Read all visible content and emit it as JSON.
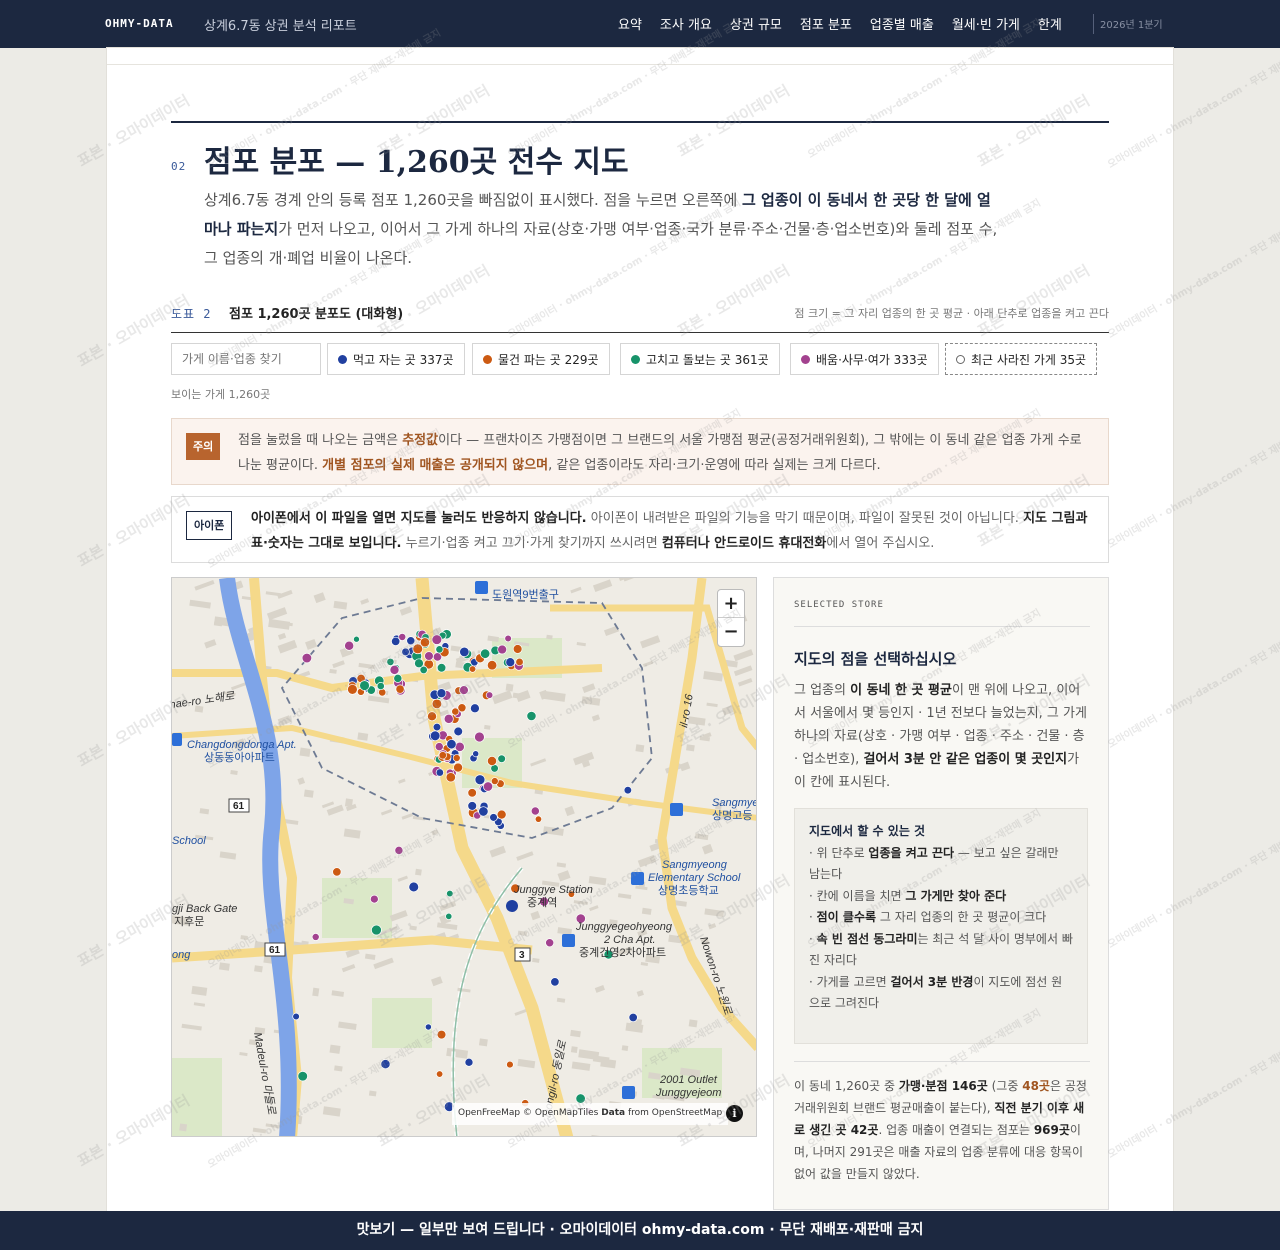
{
  "header": {
    "brand": "OHMY-DATA",
    "report_title": "상계6.7동 상권 분석 리포트",
    "nav": [
      "요약",
      "조사 개요",
      "상권 규모",
      "점포 분포",
      "업종별 매출",
      "월세·빈 가게",
      "한계"
    ],
    "period": "2026년 1분기"
  },
  "section": {
    "number": "02",
    "title": "점포 분포 — 1,260곳 전수 지도",
    "lead_1": "상계6.7동 경계 안의 등록 점포 1,260곳을 빠짐없이 표시했다. 점을 누르면 오른쪽에 ",
    "lead_bold": "그 업종이 이 동네서 한 곳당 한 달에 얼마나 파는지",
    "lead_2": "가 먼저 나오고, 이어서 그 가게 하나의 자료(상호·가맹 여부·업종·국가 분류·주소·건물·층·업소번호)와 둘레 점포 수, 그 업종의 개·폐업 비율이 나온다."
  },
  "figure": {
    "label": "도표 2",
    "title": "점포 1,260곳 분포도 (대화형)",
    "note": "점 크기 = 그 자리 업종의 한 곳 평균 · 아래 단추로 업종을 켜고 끈다"
  },
  "filters": {
    "search_placeholder": "가게 이름·업종 찾기",
    "chips": [
      {
        "label": "먹고 자는 곳 337곳",
        "color": "#2140a0"
      },
      {
        "label": "물건 파는 곳 229곳",
        "color": "#cc5a12"
      },
      {
        "label": "고치고 돌보는 곳 361곳",
        "color": "#17936a"
      },
      {
        "label": "배움·사무·여가 333곳",
        "color": "#a3428f"
      },
      {
        "label": "최근 사라진 가게 35곳",
        "color": "#888888"
      }
    ],
    "visible_count": "보이는 가게 1,260곳"
  },
  "warning": {
    "tag": "주의",
    "text_1": "점을 눌렀을 때 나오는 금액은 ",
    "bold_1": "추정값",
    "text_2": "이다 — 프랜차이즈 가맹점이면 그 브랜드의 서울 가맹점 평균(공정거래위원회), 그 밖에는 이 동네 같은 업종 가게 수로 나눈 평균이다. ",
    "bold_2": "개별 점포의 실제 매출은 공개되지 않으며",
    "text_3": ", 같은 업종이라도 자리·크기·운영에 따라 실제는 크게 다르다."
  },
  "iphone": {
    "tag": "아이폰",
    "bold_1": "아이폰에서 이 파일을 열면 지도를 눌러도 반응하지 않습니다.",
    "text_1": " 아이폰이 내려받은 파일의 기능을 막기 때문이며, 파일이 잘못된 것이 아닙니다. ",
    "bold_2": "지도 그림과 표·숫자는 그대로 보입니다.",
    "text_2": " 누르기·업종 켜고 끄기·가게 찾기까지 쓰시려면 ",
    "bold_3": "컴퓨터나 안드로이드 휴대전화",
    "text_3": "에서 열어 주십시오."
  },
  "map": {
    "zoom_in": "+",
    "zoom_out": "−",
    "attribution_1": "OpenFreeMap © OpenMapTiles ",
    "attribution_bold": "Data",
    "attribution_2": " from OpenStreetMap",
    "info": "i",
    "labels": {
      "station_exit": "도원역9번출구",
      "changdong_en": "Changdongdonga Apt.",
      "changdong_ko": "상동동아아파트",
      "hae_ro": "hae-ro 노해로",
      "road_61_a": "61",
      "road_61_b": "61",
      "road_3": "3",
      "junggye_en": "Junggye Station",
      "junggye_ko": "중계역",
      "sangmyeong_el_en": "Sangmyeong",
      "sangmyeong_el_en2": "Elementary School",
      "sangmyeong_el_ko": "상명초등학교",
      "sangmyeong_hi_en": "Sangmyeong Hi",
      "sangmyeong_hi_ko": "상명고등",
      "junggye2_en": "Junggyegeohyeong",
      "junggye2_en2": "2 Cha Apt.",
      "junggye2_ko": "중계건영2차아파트",
      "outlet_en": "2001 Outlet",
      "outlet_en2": "Junggyejeom",
      "back_gate_en": "gji Back Gate",
      "back_gate_ko": "지후문",
      "school": "School",
      "ong": "ong",
      "dongil_ro": "Dongil-ro 동일로",
      "nowon_ro": "Nowon-ro 노원로",
      "madeul_ro": "Madeul-ro 마들로",
      "il_ro": "il-ro 16"
    }
  },
  "panel": {
    "kicker": "SELECTED STORE",
    "title": "지도의 점을 선택하십시오",
    "body_1": "그 업종의 ",
    "body_bold_1": "이 동네 한 곳 평균",
    "body_2": "이 맨 위에 나오고, 이어서 서울에서 몇 등인지 · 1년 전보다 늘었는지, 그 가게 하나의 자료(상호 · 가맹 여부 · 업종 · 주소 · 건물 · 층 · 업소번호), ",
    "body_bold_2": "걸어서 3분 안 같은 업종이 몇 곳인지",
    "body_3": "가 이 칸에 표시된다.",
    "howto_title": "지도에서 할 수 있는 것",
    "howto": [
      {
        "pre": "· 위 단추로 ",
        "bold": "업종을 켜고 끈다",
        "post": " — 보고 싶은 갈래만 남는다"
      },
      {
        "pre": "· 칸에 이름을 치면 ",
        "bold": "그 가게만 찾아 준다",
        "post": ""
      },
      {
        "pre": "· ",
        "bold": "점이 클수록",
        "post": " 그 자리 업종의 한 곳 평균이 크다"
      },
      {
        "pre": "· ",
        "bold": "속 빈 점선 동그라미",
        "post": "는 최근 석 달 사이 명부에서 빠진 자리다"
      },
      {
        "pre": "· 가게를 고르면 ",
        "bold": "걸어서 3분 반경",
        "post": "이 지도에 점선 원으로 그려진다"
      }
    ],
    "foot_1": "이 동네 1,260곳 중 ",
    "foot_bold_1": "가맹·분점 146곳",
    "foot_2": " (그중 ",
    "foot_orange": "48곳",
    "foot_3": "은 공정거래위원회 브랜드 평균매출이 붙는다), ",
    "foot_bold_2": "직전 분기 이후 새로 생긴 곳 42곳",
    "foot_4": ". 업종 매출이 연결되는 점포는 ",
    "foot_bold_3": "969곳",
    "foot_5": "이며, 나머지 291곳은 매출 자료의 업종 분류에 대응 항목이 없어 값을 만들지 않았다."
  },
  "footer": {
    "text": "맛보기 — 일부만 보여 드립니다 · 오마이데이터 ohmy-data.com · 무단 재배포·재판매 금지"
  },
  "watermark": {
    "main": "표본 · 오마이데이터",
    "small": "오마이데이터 · ohmy-data.com · 무단 재배포·재판매 금지"
  }
}
